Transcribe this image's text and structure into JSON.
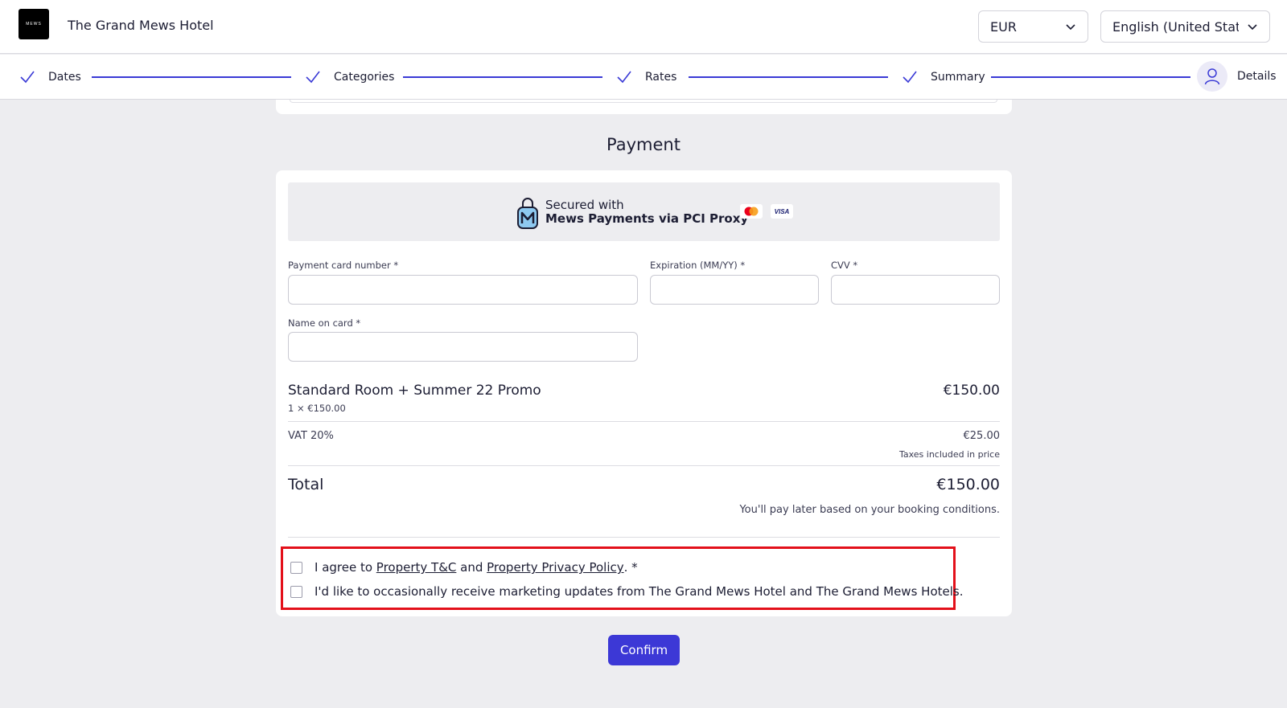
{
  "header": {
    "logo_text": "MEWS",
    "hotel_name": "The Grand Mews Hotel",
    "currency": "EUR",
    "language": "English (United Stat..."
  },
  "stepper": {
    "steps": [
      {
        "label": "Dates",
        "state": "done"
      },
      {
        "label": "Categories",
        "state": "done"
      },
      {
        "label": "Rates",
        "state": "done"
      },
      {
        "label": "Summary",
        "state": "done"
      },
      {
        "label": "Details",
        "state": "current"
      }
    ]
  },
  "payment": {
    "title": "Payment",
    "secure_line1": "Secured with",
    "secure_line2": "Mews Payments via PCI Proxy",
    "visa_label": "VISA",
    "fields": {
      "card_number_label": "Payment card number *",
      "expiration_label": "Expiration (MM/YY) *",
      "cvv_label": "CVV *",
      "name_label": "Name on card *"
    }
  },
  "order": {
    "item_title": "Standard Room + Summer 22 Promo",
    "item_price": "€150.00",
    "item_sub": "1 × €150.00",
    "vat_label": "VAT 20%",
    "vat_value": "€25.00",
    "tax_note": "Taxes included in price",
    "total_label": "Total",
    "total_value": "€150.00",
    "pay_note": "You'll pay later based on your booking conditions."
  },
  "consent": {
    "agree_prefix": "I agree to ",
    "tc_link": "Property T&C",
    "and": " and ",
    "privacy_link": "Property Privacy Policy",
    "agree_suffix": ". *",
    "marketing": "I'd like to occasionally receive marketing updates from The Grand Mews Hotel and The Grand Mews Hotels."
  },
  "actions": {
    "confirm_label": "Confirm"
  },
  "colors": {
    "accent": "#3c38d6",
    "highlight": "#e3101a"
  }
}
